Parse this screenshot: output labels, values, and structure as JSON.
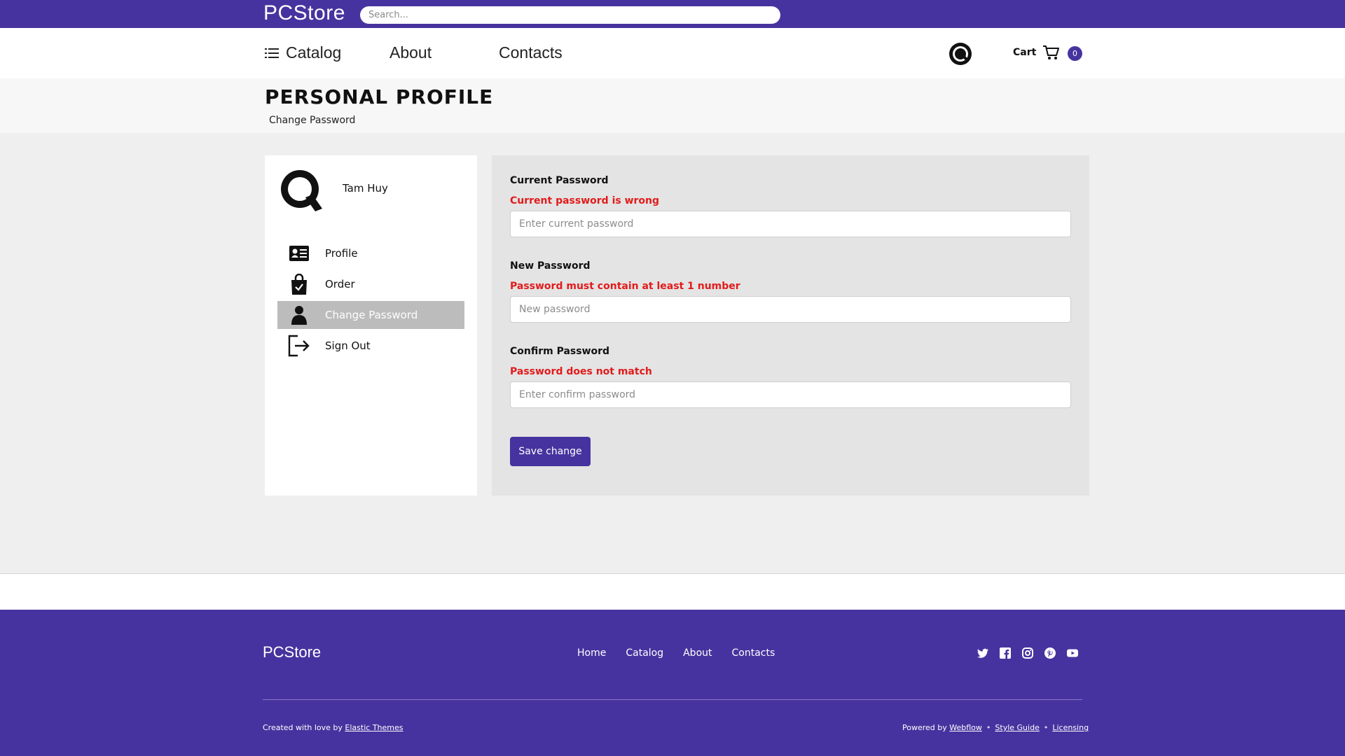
{
  "topbar": {
    "brand": "PCStore",
    "search_placeholder": "Search..."
  },
  "nav": {
    "catalog": "Catalog",
    "about": "About",
    "contacts": "Contacts",
    "cart_label": "Cart",
    "cart_count": "0"
  },
  "page": {
    "title": "PERSONAL PROFILE",
    "breadcrumb": "Change Password"
  },
  "sidebar": {
    "user_name": "Tam Huy",
    "items": [
      {
        "label": "Profile",
        "icon": "id-card-icon"
      },
      {
        "label": "Order",
        "icon": "shopping-bag-icon"
      },
      {
        "label": "Change Password",
        "icon": "person-icon",
        "active": true
      },
      {
        "label": "Sign Out",
        "icon": "sign-out-icon"
      }
    ]
  },
  "form": {
    "current": {
      "label": "Current Password",
      "error": "Current password is wrong",
      "placeholder": "Enter current password"
    },
    "new": {
      "label": "New Password",
      "error": "Password must contain at least 1 number",
      "placeholder": "New password"
    },
    "confirm": {
      "label": "Confirm Password",
      "error": "Password does not match",
      "placeholder": "Enter confirm password"
    },
    "save_label": "Save change"
  },
  "footer": {
    "brand": "PCStore",
    "links": [
      "Home",
      "Catalog",
      "About",
      "Contacts"
    ],
    "socials": [
      "twitter-icon",
      "facebook-icon",
      "instagram-icon",
      "pinterest-icon",
      "youtube-icon"
    ],
    "created_prefix": "Created with love by ",
    "created_link": "Elastic Themes",
    "powered_prefix": "Powered by ",
    "powered_link": "Webflow",
    "style_guide": "Style Guide",
    "licensing": "Licensing",
    "separator": "•"
  },
  "colors": {
    "brand_purple": "#47339f",
    "error_red": "#e21b1b",
    "active_menu_bg": "#bcbcbc"
  }
}
